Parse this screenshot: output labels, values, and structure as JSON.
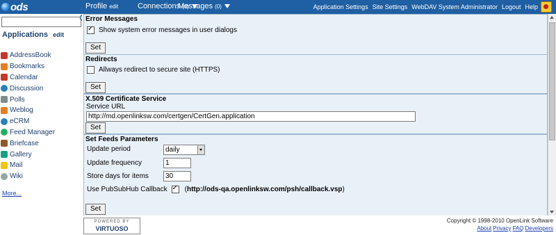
{
  "topbar": {
    "logo": "ods",
    "menus": [
      {
        "label": "Profile",
        "sub": "edit"
      },
      {
        "label": "Connections",
        "sub": "(0)"
      },
      {
        "label": "Messages",
        "sub": "(0)"
      }
    ],
    "links": [
      "Application Settings",
      "Site Settings",
      "WebDAV System Administrator",
      "Logout",
      "Help"
    ]
  },
  "sidebar": {
    "search_value": "",
    "title": "Applications",
    "edit": "edit",
    "apps": [
      {
        "label": "AddressBook",
        "color": "#c0392b"
      },
      {
        "label": "Bookmarks",
        "color": "#e67e22"
      },
      {
        "label": "Calendar",
        "color": "#c0392b"
      },
      {
        "label": "Discussion",
        "color": "#2980b9"
      },
      {
        "label": "Polls",
        "color": "#7f8c8d"
      },
      {
        "label": "Weblog",
        "color": "#e67e22"
      },
      {
        "label": "eCRM",
        "color": "#2980b9"
      },
      {
        "label": "Feed Manager",
        "color": "#27ae60"
      },
      {
        "label": "Briefcase",
        "color": "#8e5a2b"
      },
      {
        "label": "Gallery",
        "color": "#16a085"
      },
      {
        "label": "Mail",
        "color": "#f1c40f"
      },
      {
        "label": "Wiki",
        "color": "#95a5a6"
      }
    ],
    "more": "More..."
  },
  "main": {
    "error_messages": {
      "title": "Error Messages",
      "checkbox_label": "Show system error messages in user dialogs",
      "checked": true,
      "button": "Set"
    },
    "redirects": {
      "title": "Redirects",
      "checkbox_label": "Allways redirect to secure site (HTTPS)",
      "checked": false,
      "button": "Set"
    },
    "x509": {
      "title": "X.509 Certificate Service",
      "field_label": "Service URL",
      "field_value": "http://md.openlinksw.com/certgen/CertGen.application",
      "button": "Set"
    },
    "feeds": {
      "title": "Set Feeds Parameters",
      "update_period_label": "Update period",
      "update_period_value": "daily",
      "update_frequency_label": "Update frequency",
      "update_frequency_value": "1",
      "store_days_label": "Store days for items",
      "store_days_value": "30",
      "pubsub_label": "Use PubSubHub Callback",
      "pubsub_checked": true,
      "pubsub_url_prefix": "(",
      "pubsub_url": "http://ods-qa.openlinksw.com/psh/callback.vsp",
      "pubsub_url_suffix": ")",
      "button": "Set"
    }
  },
  "footer": {
    "badge_top": "POWERED BY",
    "badge_main": "VIRTUOSO",
    "copyright": "Copyright © 1998-2010 OpenLink Software",
    "links": [
      "About",
      "Privacy",
      "FAQ",
      "Developers"
    ]
  }
}
